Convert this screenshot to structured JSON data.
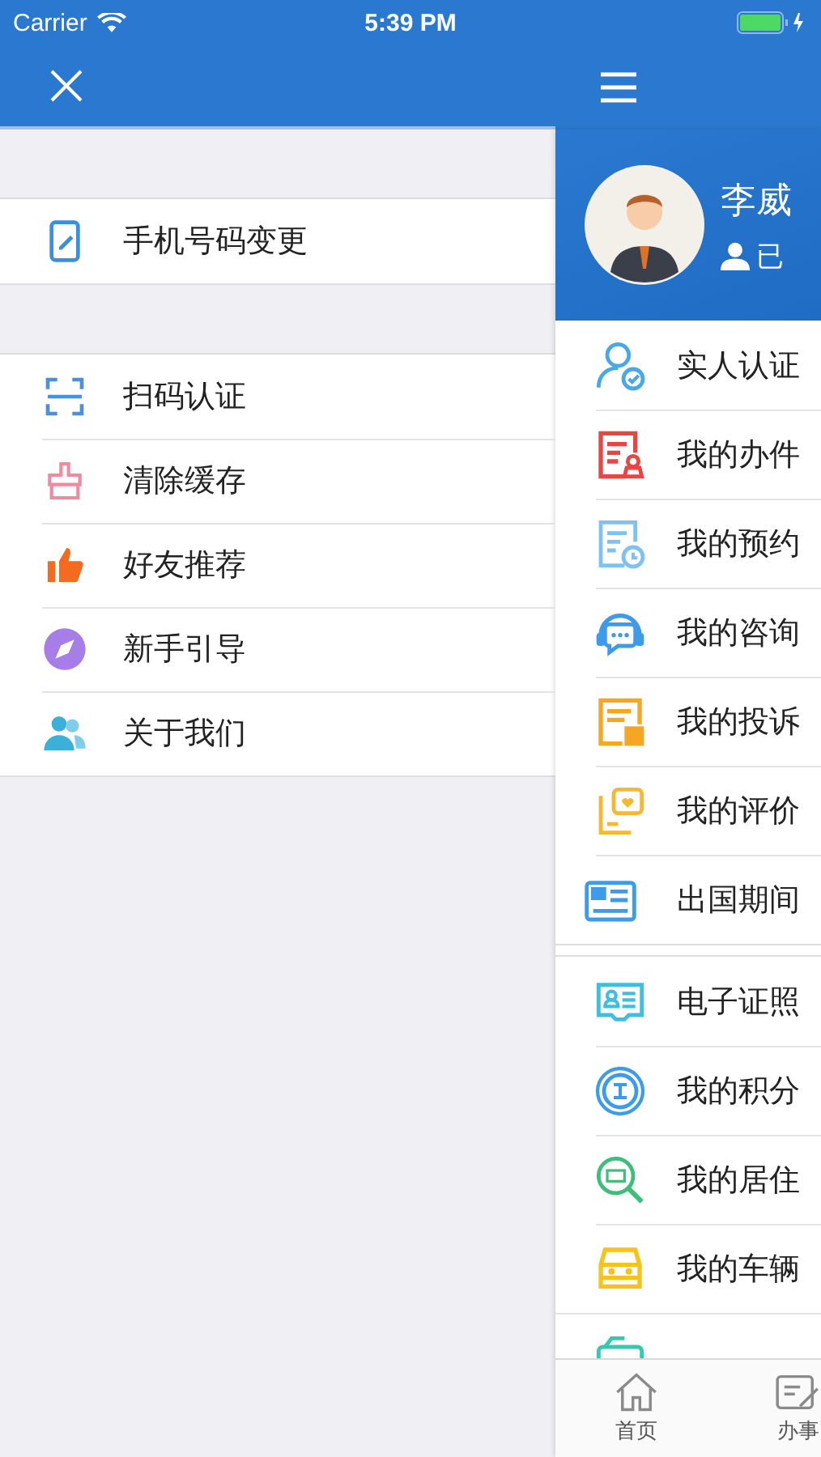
{
  "status_bar": {
    "carrier": "Carrier",
    "time": "5:39 PM"
  },
  "left_menu": {
    "groups": [
      [
        {
          "label": "手机号码变更"
        }
      ],
      [
        {
          "label": "扫码认证"
        },
        {
          "label": "清除缓存"
        },
        {
          "label": "好友推荐"
        },
        {
          "label": "新手引导"
        },
        {
          "label": "关于我们"
        }
      ]
    ]
  },
  "profile": {
    "name": "李威",
    "status": "已"
  },
  "right_menu": {
    "groups": [
      [
        {
          "label": "实人认证"
        },
        {
          "label": "我的办件"
        },
        {
          "label": "我的预约"
        },
        {
          "label": "我的咨询"
        },
        {
          "label": "我的投诉"
        },
        {
          "label": "我的评价"
        },
        {
          "label": "出国期间"
        }
      ],
      [
        {
          "label": "电子证照"
        },
        {
          "label": "我的积分"
        },
        {
          "label": "我的居住"
        },
        {
          "label": "我的车辆"
        }
      ]
    ]
  },
  "tab_bar": [
    {
      "label": "首页"
    },
    {
      "label": "办事"
    }
  ]
}
